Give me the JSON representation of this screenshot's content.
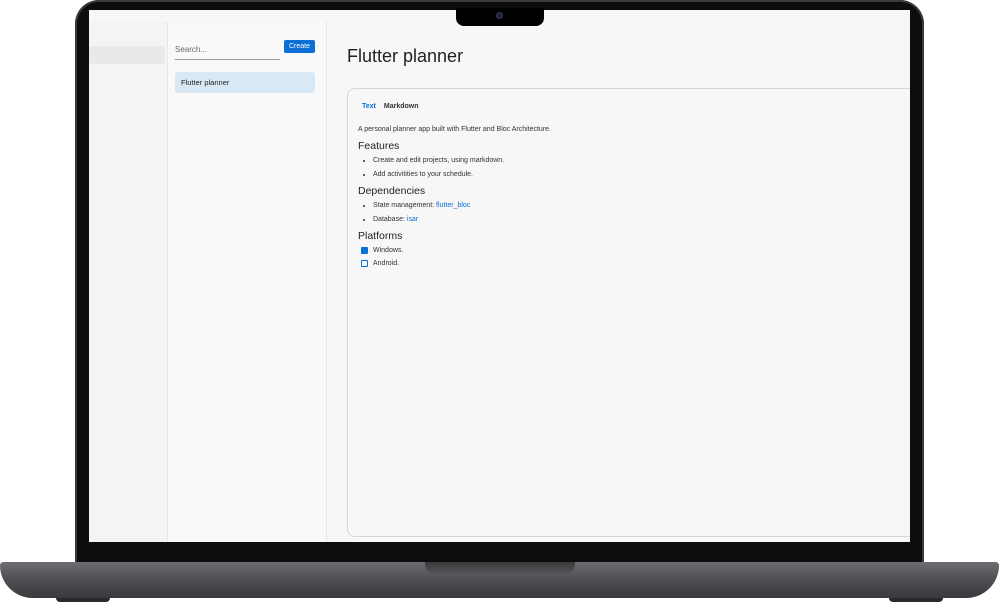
{
  "list_panel": {
    "search_placeholder": "Search...",
    "create_label": "Create",
    "items": [
      {
        "label": "Flutter planner"
      }
    ]
  },
  "main": {
    "title": "Flutter planner",
    "tabs": [
      {
        "label": "Text",
        "active": true
      },
      {
        "label": "Markdown",
        "active": false
      }
    ],
    "intro": "A personal planner app built with Flutter and Bloc Architecture.",
    "features_heading": "Features",
    "features": [
      "Create and edit projects, using markdown.",
      "Add activitities to your schedule."
    ],
    "dependencies_heading": "Dependencies",
    "dependencies": [
      {
        "label": "State management: ",
        "link": "flutter_bloc"
      },
      {
        "label": "Database: ",
        "link": "isar"
      }
    ],
    "platforms_heading": "Platforms",
    "platforms": [
      {
        "label": "Windows.",
        "checked": true
      },
      {
        "label": "Android.",
        "checked": false
      }
    ]
  },
  "colors": {
    "accent": "#0a6fd6",
    "selected_item": "#d9e8f5"
  }
}
